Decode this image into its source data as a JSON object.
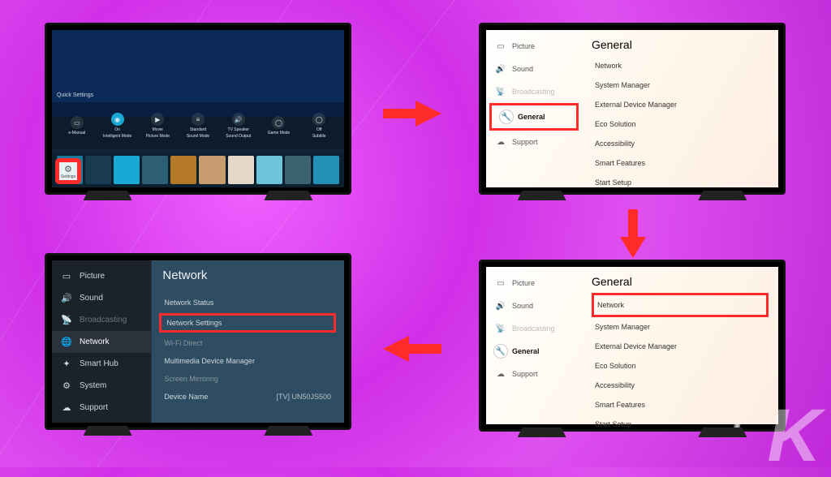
{
  "panel1": {
    "quickSettingsTitle": "Quick Settings",
    "items": [
      {
        "label": "e-Manual",
        "sub": ""
      },
      {
        "label": "On",
        "sub": "Intelligent Mode",
        "highlight": true
      },
      {
        "label": "Movie",
        "sub": "Picture Mode"
      },
      {
        "label": "Standard",
        "sub": "Sound Mode"
      },
      {
        "label": "TV Speaker",
        "sub": "Sound Output"
      },
      {
        "label": "",
        "sub": "Game Mode"
      },
      {
        "label": "Off",
        "sub": "Subtitle"
      }
    ],
    "settingsButton": "Settings"
  },
  "lightPanel": {
    "sidebar": [
      {
        "icon": "picture",
        "label": "Picture"
      },
      {
        "icon": "sound",
        "label": "Sound"
      },
      {
        "icon": "broadcast",
        "label": "Broadcasting"
      },
      {
        "icon": "wrench",
        "label": "General"
      },
      {
        "icon": "support",
        "label": "Support"
      }
    ],
    "heading": "General",
    "items": [
      "Network",
      "System Manager",
      "External Device Manager",
      "Eco Solution",
      "Accessibility",
      "Smart Features",
      "Start Setup"
    ]
  },
  "darkPanel": {
    "sidebar": [
      {
        "icon": "picture",
        "label": "Picture"
      },
      {
        "icon": "sound",
        "label": "Sound"
      },
      {
        "icon": "broadcast",
        "label": "Broadcasting"
      },
      {
        "icon": "globe",
        "label": "Network"
      },
      {
        "icon": "star",
        "label": "Smart Hub"
      },
      {
        "icon": "gear",
        "label": "System"
      },
      {
        "icon": "support",
        "label": "Support"
      }
    ],
    "heading": "Network",
    "items": [
      {
        "label": "Network Status",
        "value": ""
      },
      {
        "label": "Network Settings",
        "value": ""
      },
      {
        "label": "Wi-Fi Direct",
        "value": ""
      },
      {
        "label": "Multimedia Device Manager",
        "value": ""
      },
      {
        "label": "Screen Mirroring",
        "value": ""
      },
      {
        "label": "Device Name",
        "value": "[TV] UN50JS500"
      }
    ]
  },
  "watermark": "K"
}
